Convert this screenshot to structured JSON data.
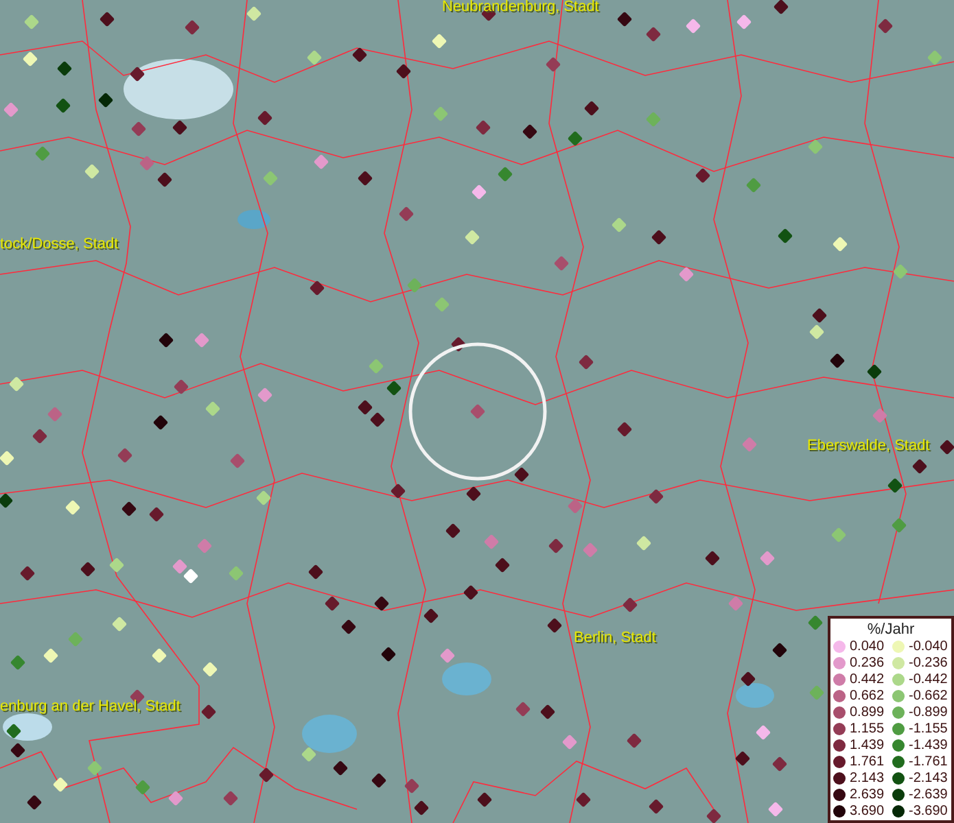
{
  "map": {
    "places": [
      {
        "name": "Neubrandenburg, Stadt"
      },
      {
        "name": "tock/Dosse, Stadt"
      },
      {
        "name": "Eberswalde, Stadt"
      },
      {
        "name": "Berlin, Stadt"
      },
      {
        "name": "enburg an der Havel, Stadt"
      }
    ]
  },
  "legend": {
    "title": "%/Jahr",
    "increase": [
      {
        "label": "0.040",
        "color": "#f5b8ea"
      },
      {
        "label": "0.236",
        "color": "#e399cb"
      },
      {
        "label": "0.442",
        "color": "#cf7ca8"
      },
      {
        "label": "0.662",
        "color": "#bb6386"
      },
      {
        "label": "0.899",
        "color": "#a84e6c"
      },
      {
        "label": "1.155",
        "color": "#943c56"
      },
      {
        "label": "1.439",
        "color": "#7e2a40"
      },
      {
        "label": "1.761",
        "color": "#671a2c"
      },
      {
        "label": "2.143",
        "color": "#4d0f1c"
      },
      {
        "label": "2.639",
        "color": "#360812"
      },
      {
        "label": "3.690",
        "color": "#22040a"
      }
    ],
    "decrease": [
      {
        "label": "-0.040",
        "color": "#eef7b4"
      },
      {
        "label": "-0.236",
        "color": "#cfe8a2"
      },
      {
        "label": "-0.442",
        "color": "#acd88a"
      },
      {
        "label": "-0.662",
        "color": "#8cc673"
      },
      {
        "label": "-0.899",
        "color": "#6db25a"
      },
      {
        "label": "-1.155",
        "color": "#4f9c42"
      },
      {
        "label": "-1.439",
        "color": "#36872f"
      },
      {
        "label": "-1.761",
        "color": "#216c1e"
      },
      {
        "label": "-2.143",
        "color": "#125212"
      },
      {
        "label": "-2.639",
        "color": "#0a3c0b"
      },
      {
        "label": "-3.690",
        "color": "#052806"
      }
    ]
  }
}
